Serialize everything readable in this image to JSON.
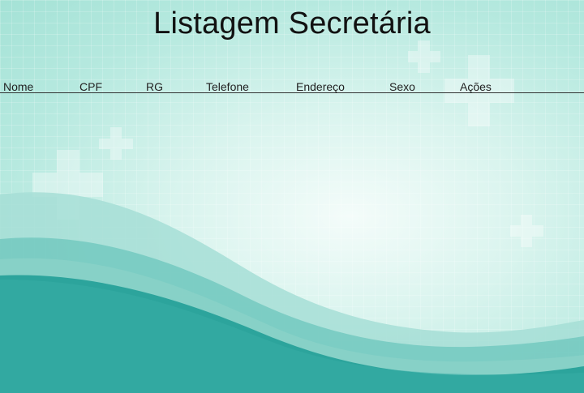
{
  "page": {
    "title": "Listagem Secretária"
  },
  "table": {
    "columns": [
      "Nome",
      "CPF",
      "RG",
      "Telefone",
      "Endereço",
      "Sexo",
      "Ações"
    ],
    "rows": []
  },
  "background": {
    "icons": [
      "medical-cross-icon"
    ],
    "colors": {
      "wave_dark": "#1e9a94",
      "wave_mid": "#5fbcb4",
      "wave_light": "#a6ded6",
      "bg_light": "#dff6f1"
    }
  }
}
